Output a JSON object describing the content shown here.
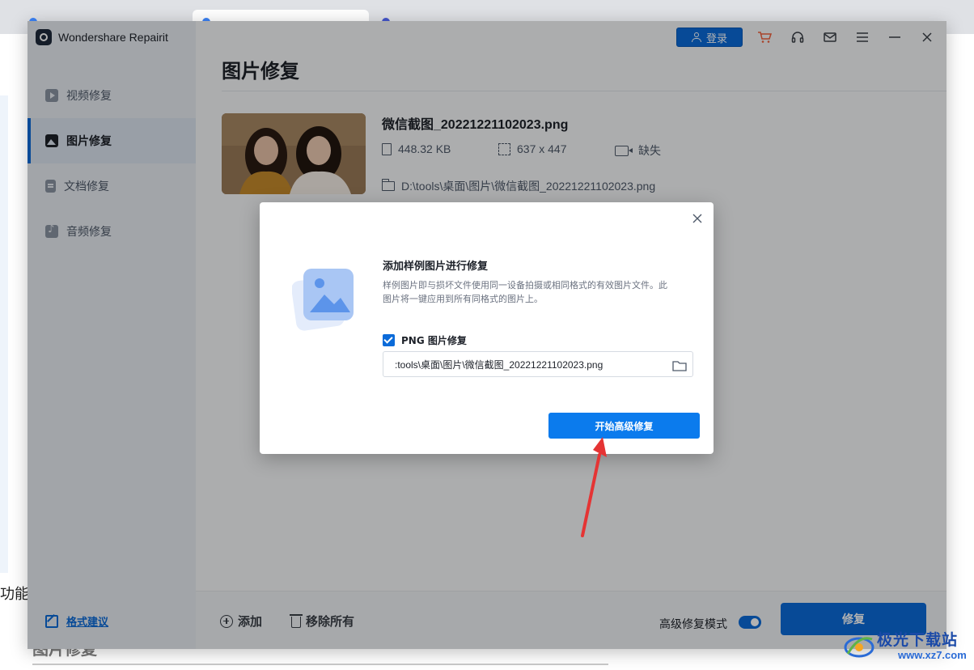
{
  "app": {
    "name": "Wondershare Repairit",
    "login_label": "登录",
    "topbar_icons": [
      "cart-icon",
      "headset-icon",
      "mail-icon",
      "menu-icon",
      "minimize-icon",
      "close-icon"
    ],
    "accent_color": "#0b6bd9"
  },
  "sidebar": {
    "items": [
      {
        "label": "视频修复",
        "icon": "video-icon"
      },
      {
        "label": "图片修复",
        "icon": "image-icon",
        "active": true
      },
      {
        "label": "文档修复",
        "icon": "document-icon"
      },
      {
        "label": "音频修复",
        "icon": "audio-icon"
      }
    ],
    "feedback_label": "格式建议"
  },
  "main": {
    "title": "图片修复",
    "file": {
      "name": "微信截图_20221221102023.png",
      "size": "448.32  KB",
      "dimensions": "637 x 447",
      "camera": "缺失",
      "path": "D:\\tools\\桌面\\图片\\微信截图_20221221102023.png"
    },
    "footer": {
      "add_label": "添加",
      "remove_all_label": "移除所有",
      "advanced_mode_label": "高级修复模式",
      "advanced_mode_on": true,
      "repair_label": "修复"
    }
  },
  "dialog": {
    "title": "添加样例图片进行修复",
    "description": "样例图片即与损坏文件使用同一设备拍摄或相同格式的有效图片文件。此图片将一键应用到所有同格式的图片上。",
    "checkbox_label": "PNG 图片修复",
    "checkbox_checked": true,
    "sample_path": ":tools\\桌面\\图片\\微信截图_20221221102023.png",
    "start_label": "开始高级修复"
  },
  "background": {
    "page_text_left": "功能,",
    "page_text_bottom": "图片修复"
  },
  "watermark": {
    "text": "极光下载站",
    "url": "www.xz7.com"
  }
}
